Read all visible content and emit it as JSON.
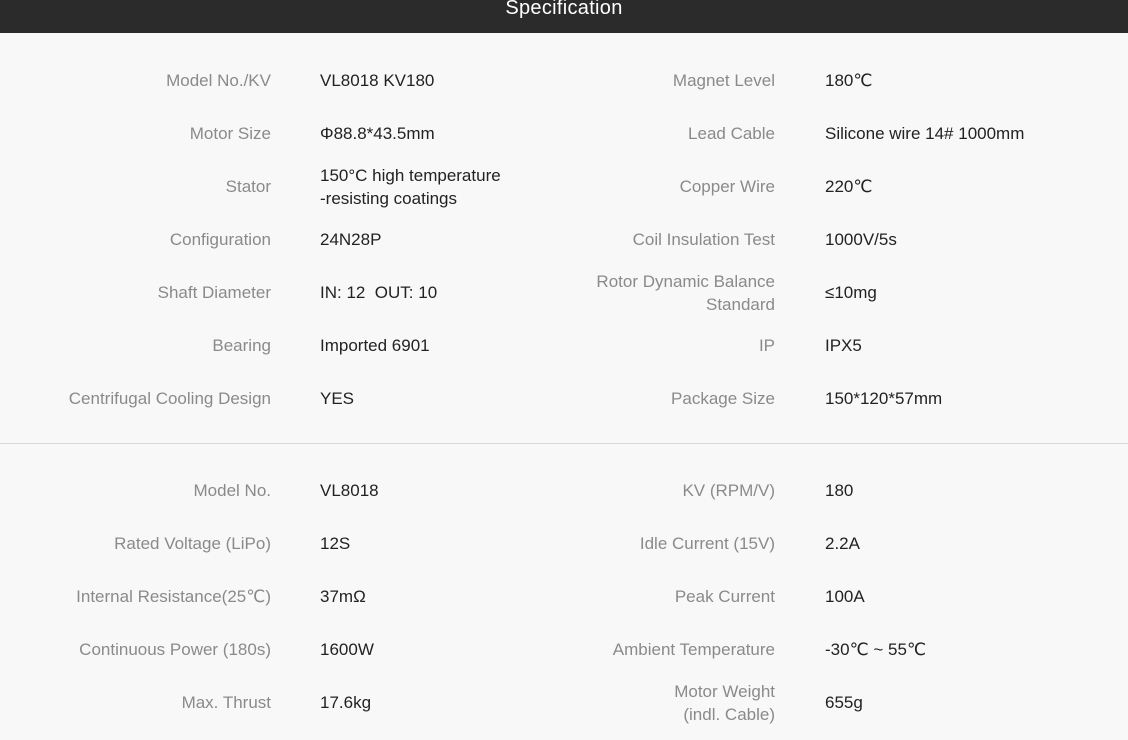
{
  "header": {
    "title": "Specification"
  },
  "spec_table_1": [
    {
      "left_label": "Model No./KV",
      "left_value": "VL8018 KV180",
      "right_label": "Magnet Level",
      "right_value": "180℃"
    },
    {
      "left_label": "Motor Size",
      "left_value": "Φ88.8*43.5mm",
      "right_label": "Lead Cable",
      "right_value": "Silicone wire 14# 1000mm"
    },
    {
      "left_label": "Stator",
      "left_value": "150°C high temperature\n-resisting coatings",
      "right_label": "Copper Wire",
      "right_value": "220℃"
    },
    {
      "left_label": "Configuration",
      "left_value": "24N28P",
      "right_label": "Coil Insulation Test",
      "right_value": "1000V/5s"
    },
    {
      "left_label": "Shaft Diameter",
      "left_value": "IN: 12  OUT: 10",
      "right_label": "Rotor Dynamic Balance\nStandard",
      "right_value": "≤10mg"
    },
    {
      "left_label": "Bearing",
      "left_value": "Imported 6901",
      "right_label": "IP",
      "right_value": "IPX5"
    },
    {
      "left_label": "Centrifugal Cooling Design",
      "left_value": "YES",
      "right_label": "Package Size",
      "right_value": "150*120*57mm"
    }
  ],
  "spec_table_2": [
    {
      "left_label": "Model No.",
      "left_value": "VL8018",
      "right_label": "KV (RPM/V)",
      "right_value": "180"
    },
    {
      "left_label": "Rated Voltage (LiPo)",
      "left_value": "12S",
      "right_label": "Idle Current (15V)",
      "right_value": "2.2A"
    },
    {
      "left_label": "Internal Resistance(25℃)",
      "left_value": "37mΩ",
      "right_label": "Peak Current",
      "right_value": "100A"
    },
    {
      "left_label": "Continuous Power (180s)",
      "left_value": "1600W",
      "right_label": "Ambient Temperature",
      "right_value": "-30℃ ~ 55℃"
    },
    {
      "left_label": "Max. Thrust",
      "left_value": "17.6kg",
      "right_label": "Motor Weight\n(indl. Cable)",
      "right_value": "655g"
    }
  ]
}
